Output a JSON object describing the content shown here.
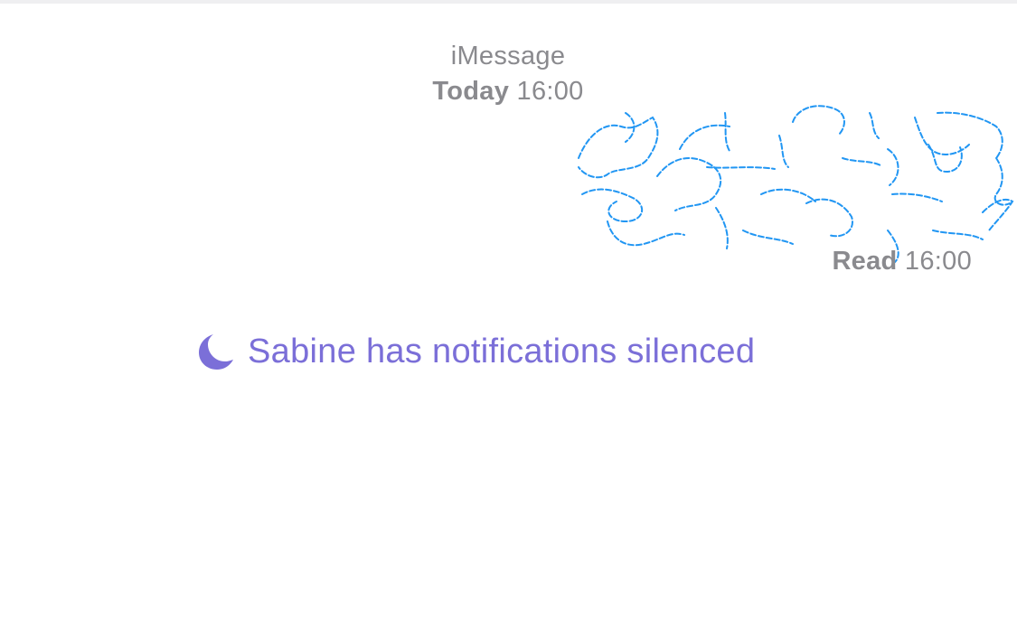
{
  "header": {
    "service": "iMessage",
    "day": "Today",
    "time": "16:00"
  },
  "message": {
    "content": "[redacted scribble]",
    "receipt_state": "Read",
    "receipt_time": "16:00"
  },
  "focus_status": {
    "icon": "moon-icon",
    "text": "Sabine has notifications silenced",
    "color": "#7b6fd8"
  },
  "colors": {
    "meta_text": "#8a8a8e",
    "scribble": "#2196f3",
    "background": "#ffffff"
  }
}
